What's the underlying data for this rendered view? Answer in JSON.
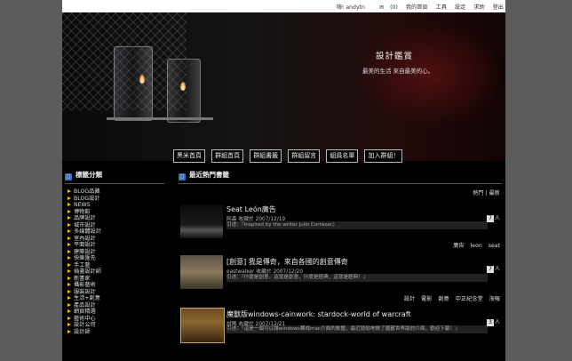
{
  "topbar": {
    "user": "嗨! andytn",
    "mail": "(0)",
    "links": [
      "我的首頁",
      "工具",
      "設定",
      "求助",
      "登出"
    ]
  },
  "banner": {
    "title": "設計鑑賞",
    "subtitle": "最美的生活 來自最美的心。"
  },
  "nav": [
    "黑米首頁",
    "群組首頁",
    "群組書籤",
    "群組留言",
    "組員名單",
    "加入群組！"
  ],
  "sidebar": {
    "heading": "標籤分類",
    "items": [
      "BLOG品藏",
      "BLOG設計",
      "NEWS",
      "博物館",
      "品牌設計",
      "城市設計",
      "多媒體設計",
      "室內設計",
      "平面設計",
      "建築設計",
      "快樂匯先",
      "手工藝",
      "插畫設計師",
      "新書家",
      "攝影藝術",
      "服裝設計",
      "生活+創意",
      "產品設計",
      "網頁精選",
      "藝術中心",
      "設計公司",
      "設計師"
    ]
  },
  "main": {
    "heading": "最近熱門書籤",
    "sort": [
      "熱門",
      "最新"
    ],
    "posts": [
      {
        "title": "Seat León廣告",
        "meta": "阿森 收藏於 2007/12/19",
        "snippet": "引述：『Inspired by the writer Julio Cortázar』",
        "count": "7",
        "count_unit": "人",
        "tags": [
          "廣告",
          "leon",
          "seat"
        ]
      },
      {
        "title": "[創意] 我是傳奇，來自各國的創意傳奇",
        "meta": "eastwalker 收藏於 2007/12/20",
        "snippet": "引述：『什麼是創意，這就是創意，什麼是經典，這就是經典！』",
        "count": "7",
        "count_unit": "人",
        "tags": [
          "設計",
          "電影",
          "創意",
          "中正紀念堂",
          "海報"
        ]
      },
      {
        "title": "魔獸版windows-cainwork: stardock-world of warcraft",
        "meta": "試圖 收藏於 2007/12/21",
        "snippet": "引述：『這是一個可以讓windows轉成mac介面的軟體，最近勁勁地做了魔獸世界版的介面，歡迎下載！』",
        "count": "3",
        "count_unit": "人",
        "tags": []
      }
    ]
  }
}
